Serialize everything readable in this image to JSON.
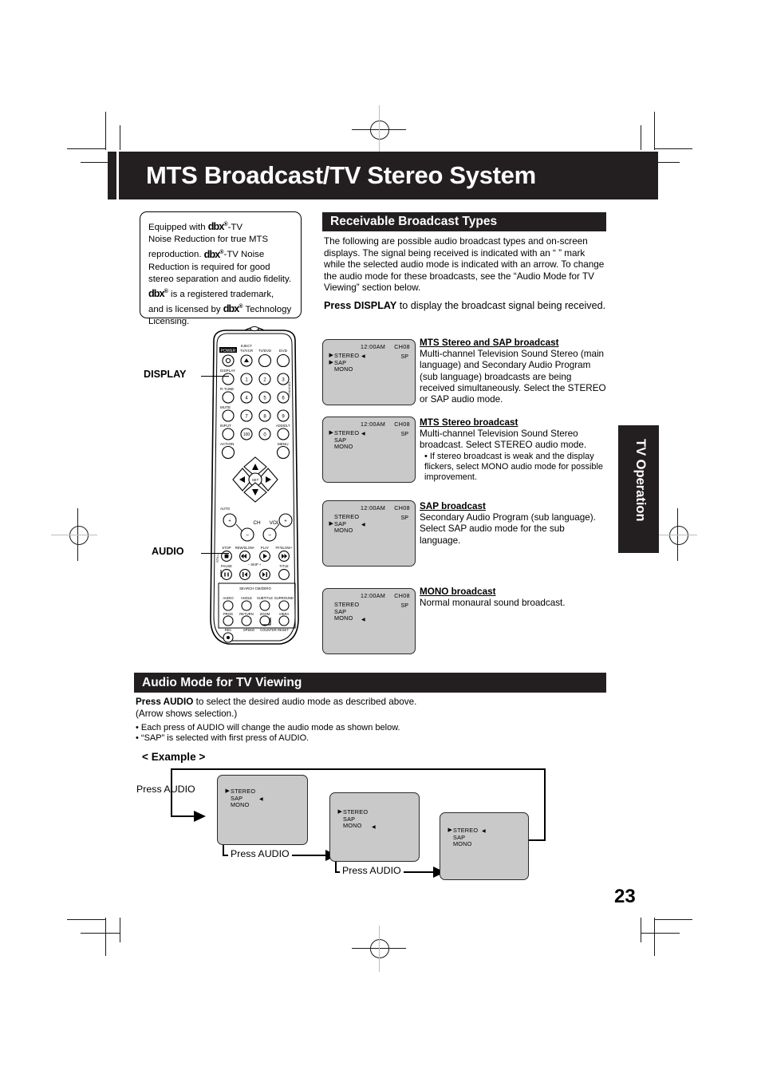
{
  "page": {
    "title": "MTS Broadcast/TV Stereo System",
    "number": "23",
    "side_tab": "TV Operation"
  },
  "dbx_note": {
    "line1_a": "Equipped with ",
    "logo": "dbx",
    "reg": "®",
    "line1_b": "-TV",
    "line2": "Noise Reduction for true MTS",
    "line3_a": "reproduction. ",
    "line3_b": "-TV Noise",
    "line4": "Reduction is required for good",
    "line5": "stereo separation and audio fidelity.",
    "line6": " is a registered trademark,",
    "line7_a": "and is licensed by ",
    "line7_b": " Technology",
    "line8": "Licensing."
  },
  "remote": {
    "display_callout": "DISPLAY",
    "audio_callout": "AUDIO"
  },
  "receivable": {
    "heading": "Receivable Broadcast Types",
    "intro": "The following are possible audio broadcast types and on-screen displays. The signal being received is indicated with an “ ” mark while the selected audio mode is indicated with an arrow. To change the audio mode for these broadcasts, see the “Audio Mode for TV Viewing” section below.",
    "press_bold": "Press DISPLAY",
    "press_rest": " to display the broadcast signal being received.",
    "items": [
      {
        "heading": "MTS Stereo and SAP broadcast",
        "body": "Multi-channel Television Sound Stereo (main language) and Secondary Audio Program (sub language) broadcasts are being received simultaneously. Select the STEREO or SAP audio mode.",
        "screen": {
          "time": "12:00AM",
          "channel": "CH08",
          "speed": "SP",
          "rows": [
            {
              "label": "STEREO",
              "signal": true,
              "selected": true
            },
            {
              "label": "SAP",
              "signal": true,
              "selected": false
            },
            {
              "label": "MONO",
              "signal": false,
              "selected": false
            }
          ]
        }
      },
      {
        "heading": "MTS Stereo broadcast",
        "body": "Multi-channel Television Sound Stereo broadcast. Select STEREO audio mode.",
        "bullet": "• If stereo broadcast is weak and the display flickers, select MONO audio mode for possible improvement.",
        "screen": {
          "time": "12:00AM",
          "channel": "CH08",
          "speed": "SP",
          "rows": [
            {
              "label": "STEREO",
              "signal": true,
              "selected": true
            },
            {
              "label": "SAP",
              "signal": false,
              "selected": false
            },
            {
              "label": "MONO",
              "signal": false,
              "selected": false
            }
          ]
        }
      },
      {
        "heading": "SAP broadcast",
        "body": "Secondary Audio Program (sub language). Select SAP audio mode for the sub language.",
        "screen": {
          "time": "12:00AM",
          "channel": "CH08",
          "speed": "SP",
          "rows": [
            {
              "label": "STEREO",
              "signal": false,
              "selected": false
            },
            {
              "label": "SAP",
              "signal": true,
              "selected": true
            },
            {
              "label": "MONO",
              "signal": false,
              "selected": false
            }
          ]
        }
      },
      {
        "heading": "MONO broadcast",
        "body": "Normal monaural sound broadcast.",
        "screen": {
          "time": "12:00AM",
          "channel": "CH08",
          "speed": "SP",
          "rows": [
            {
              "label": "STEREO",
              "signal": false,
              "selected": false
            },
            {
              "label": "SAP",
              "signal": false,
              "selected": false
            },
            {
              "label": "MONO",
              "signal": false,
              "selected": true
            }
          ]
        }
      }
    ]
  },
  "audio_mode": {
    "heading": "Audio Mode for TV Viewing",
    "press_bold": "Press AUDIO",
    "press_rest": " to select the desired audio mode as described above.",
    "paren": "(Arrow shows selection.)",
    "bullet1": "• Each press of AUDIO will change the audio mode as shown below.",
    "bullet2": "• “SAP” is selected with first press of AUDIO.",
    "example_label": "< Example >",
    "press_audio": "Press AUDIO",
    "screens": [
      {
        "rows": [
          {
            "label": "STEREO",
            "signal": true,
            "selected": false
          },
          {
            "label": "SAP",
            "signal": false,
            "selected": true
          },
          {
            "label": "MONO",
            "signal": false,
            "selected": false
          }
        ]
      },
      {
        "rows": [
          {
            "label": "STEREO",
            "signal": true,
            "selected": false
          },
          {
            "label": "SAP",
            "signal": false,
            "selected": false
          },
          {
            "label": "MONO",
            "signal": false,
            "selected": true
          }
        ]
      },
      {
        "rows": [
          {
            "label": "STEREO",
            "signal": true,
            "selected": true
          },
          {
            "label": "SAP",
            "signal": false,
            "selected": false
          },
          {
            "label": "MONO",
            "signal": false,
            "selected": false
          }
        ]
      }
    ]
  },
  "colors": {
    "ink": "#231f20",
    "screen_gray": "#c9c9c9"
  }
}
